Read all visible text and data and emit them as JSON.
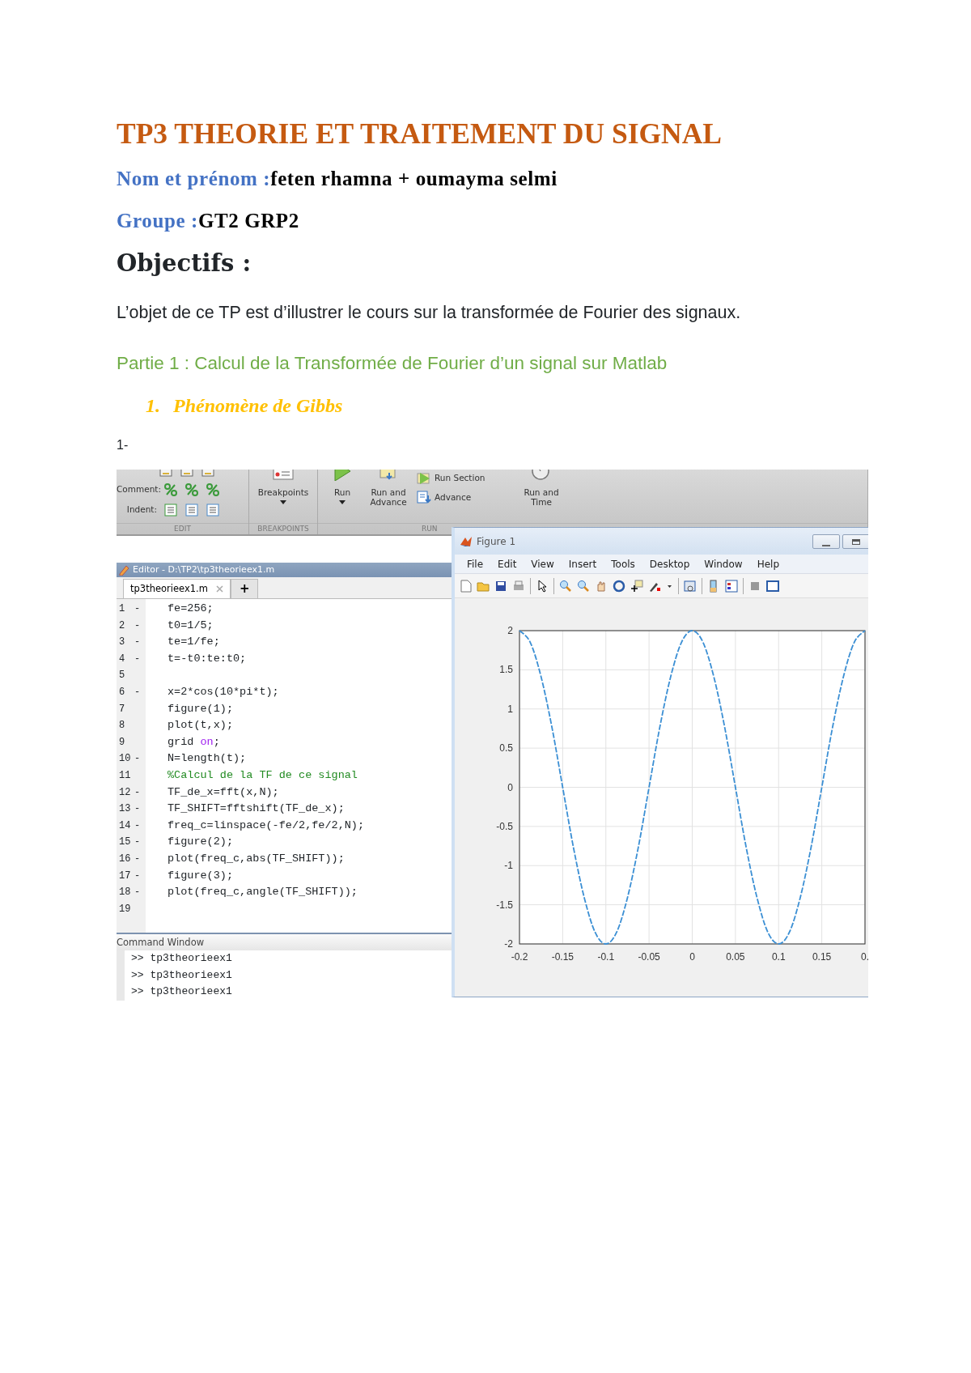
{
  "document": {
    "title": "TP3 THEORIE ET TRAITEMENT DU SIGNAL",
    "name_line": {
      "label": "Nom et prénom :",
      "value": "feten rhamna + oumayma selmi"
    },
    "group_line": {
      "label": "Groupe :",
      "value": "GT2 GRP2"
    },
    "heading": "Objectifs :",
    "paragraph": "L’objet de ce TP est d’illustrer le cours sur la transformée de Fourier des signaux.",
    "section_heading": "Partie 1 : Calcul de la Transformée de Fourier d’un signal sur Matlab",
    "subsection": {
      "number": "1.",
      "text": "Phénomène de Gibbs"
    },
    "step_label": "1-"
  },
  "screenshot": {
    "ribbon": {
      "edit_rows": [
        {
          "label": "Comment:"
        },
        {
          "label": "Indent:"
        }
      ],
      "buttons": [
        {
          "label": "Breakpoints",
          "dropdown": true
        },
        {
          "label": "Run",
          "dropdown": true
        },
        {
          "label": "Run and Advance",
          "dropdown": false
        }
      ],
      "small_buttons": [
        {
          "label": "Run Section"
        },
        {
          "label": "Advance"
        }
      ],
      "time_button": {
        "label": "Run and Time"
      },
      "sections": [
        "EDIT",
        "BREAKPOINTS",
        "RUN"
      ]
    },
    "editor": {
      "title": "Editor - D:\\TP2\\tp3theorieex1.m",
      "tabs": [
        {
          "label": "tp3theorieex1.m",
          "selected": true
        },
        {
          "label": "+",
          "selected": false
        }
      ],
      "lines": [
        {
          "number": "1",
          "marker": "-",
          "segments": [
            {
              "kind": "plain",
              "text": "fe=256;"
            }
          ]
        },
        {
          "number": "2",
          "marker": "-",
          "segments": [
            {
              "kind": "plain",
              "text": "t0=1/5;"
            }
          ]
        },
        {
          "number": "3",
          "marker": "-",
          "segments": [
            {
              "kind": "plain",
              "text": "te=1/fe;"
            }
          ]
        },
        {
          "number": "4",
          "marker": "-",
          "segments": [
            {
              "kind": "plain",
              "text": "t=-t0:te:t0;"
            }
          ]
        },
        {
          "number": "5"
        },
        {
          "number": "6",
          "marker": "-",
          "segments": [
            {
              "kind": "plain",
              "text": "x=2*cos(10*pi*t);"
            }
          ]
        },
        {
          "number": "7",
          "segments": [
            {
              "kind": "plain",
              "text": "figure(1);"
            }
          ]
        },
        {
          "number": "8",
          "segments": [
            {
              "kind": "plain",
              "text": "plot(t,x);"
            }
          ]
        },
        {
          "number": "9",
          "segments": [
            {
              "kind": "plain",
              "text": "grid "
            },
            {
              "kind": "string",
              "text": "on"
            },
            {
              "kind": "plain",
              "text": ";"
            }
          ]
        },
        {
          "number": "10",
          "marker": "-",
          "segments": [
            {
              "kind": "plain",
              "text": "N=length(t);"
            }
          ]
        },
        {
          "number": "11",
          "segments": [
            {
              "kind": "comment",
              "text": "%Calcul de la TF de ce signal"
            }
          ]
        },
        {
          "number": "12",
          "marker": "-",
          "segments": [
            {
              "kind": "plain",
              "text": "TF_de_x=fft(x,N);"
            }
          ]
        },
        {
          "number": "13",
          "marker": "-",
          "segments": [
            {
              "kind": "plain",
              "text": "TF_SHIFT=fftshift(TF_de_x);"
            }
          ]
        },
        {
          "number": "14",
          "marker": "-",
          "segments": [
            {
              "kind": "plain",
              "text": "freq_c=linspace(-fe/2,fe/2,N);"
            }
          ]
        },
        {
          "number": "15",
          "marker": "-",
          "segments": [
            {
              "kind": "plain",
              "text": "figure(2);"
            }
          ]
        },
        {
          "number": "16",
          "marker": "-",
          "segments": [
            {
              "kind": "plain",
              "text": "plot(freq_c,abs(TF_SHIFT));"
            }
          ]
        },
        {
          "number": "17",
          "marker": "-",
          "segments": [
            {
              "kind": "plain",
              "text": "figure(3);"
            }
          ]
        },
        {
          "number": "18",
          "marker": "-",
          "segments": [
            {
              "kind": "plain",
              "text": "plot(freq_c,angle(TF_SHIFT));"
            }
          ]
        },
        {
          "number": "19"
        }
      ]
    },
    "command_window": {
      "title": "Command Window",
      "prompt": ">>",
      "commands": [
        "tp3theorieex1",
        "tp3theorieex1",
        "tp3theorieex1"
      ]
    },
    "figure": {
      "title": "Figure 1",
      "menu": [
        "File",
        "Edit",
        "View",
        "Insert",
        "Tools",
        "Desktop",
        "Window",
        "Help"
      ],
      "chart_data": {
        "type": "line",
        "x": [
          -0.2,
          -0.1875,
          -0.175,
          -0.1625,
          -0.15,
          -0.1375,
          -0.125,
          -0.1125,
          -0.1,
          -0.0875,
          -0.075,
          -0.0625,
          -0.05,
          -0.0375,
          -0.025,
          -0.0125,
          0,
          0.0125,
          0.025,
          0.0375,
          0.05,
          0.0625,
          0.075,
          0.0875,
          0.1,
          0.1125,
          0.125,
          0.1375,
          0.15,
          0.1625,
          0.175,
          0.1875,
          0.2
        ],
        "series": [
          {
            "color": "#3b8fd4",
            "line_style": "dashed",
            "values": [
              2,
              1.85,
              1.41,
              0.77,
              0,
              -0.77,
              -1.41,
              -1.85,
              -2,
              -1.85,
              -1.41,
              -0.77,
              0,
              0.77,
              1.41,
              1.85,
              2,
              1.85,
              1.41,
              0.77,
              0,
              -0.77,
              -1.41,
              -1.85,
              -2,
              -1.85,
              -1.41,
              -0.77,
              0,
              0.77,
              1.41,
              1.85,
              2
            ]
          }
        ],
        "grid": true,
        "xlim": [
          -0.2,
          0.2
        ],
        "ylim": [
          -2,
          2
        ],
        "xticks": [
          -0.2,
          -0.15,
          -0.1,
          -0.05,
          0,
          0.05,
          0.1,
          0.15,
          {
            "value": 0.2,
            "label": "0."
          }
        ],
        "yticks": [
          -2,
          -1.5,
          -1,
          -0.5,
          0,
          0.5,
          1,
          1.5,
          2
        ]
      }
    }
  }
}
